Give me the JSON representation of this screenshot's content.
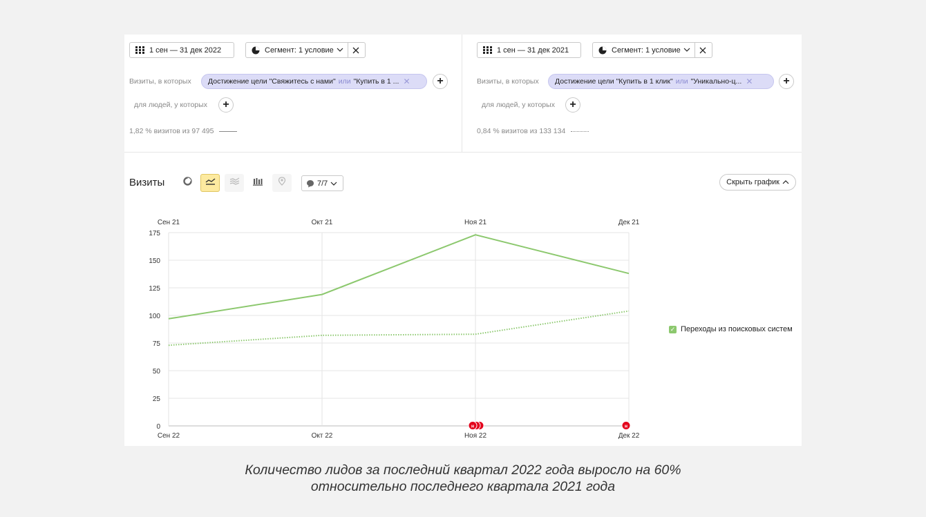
{
  "left_segment": {
    "date_label": "1 сен — 31 дек 2022",
    "segment_label": "Сегмент: 1 условие",
    "visits_label": "Визиты, в которых",
    "chip_text_a": "Достижение цели \"Свяжитесь с нами\"",
    "chip_or": "или",
    "chip_text_b": "\"Купить в 1 ...",
    "people_label": "для людей, у которых",
    "stat_text": "1,82 % визитов из 97 495"
  },
  "right_segment": {
    "date_label": "1 сен — 31 дек 2021",
    "segment_label": "Сегмент: 1 условие",
    "visits_label": "Визиты, в которых",
    "chip_text_a": "Достижение цели \"Купить в 1 клик\"",
    "chip_or": "или",
    "chip_text_b": "\"Уникально-ц...",
    "people_label": "для людей, у которых",
    "stat_text": "0,84 % визитов из 133 134"
  },
  "chart_header": {
    "title": "Визиты",
    "annotations_count": "7/7",
    "hide_label": "Скрыть график"
  },
  "legend": {
    "label": "Переходы из поисковых систем",
    "color": "#8cc86e"
  },
  "chart_data": {
    "type": "line",
    "categories_top": [
      "Сен 21",
      "Окт 21",
      "Ноя 21",
      "Дек 21"
    ],
    "categories_bottom": [
      "Сен 22",
      "Окт 22",
      "Ноя 22",
      "Дек 22"
    ],
    "yticks": [
      0,
      25,
      50,
      75,
      100,
      125,
      150,
      175
    ],
    "ylim": [
      0,
      175
    ],
    "series": [
      {
        "style": "solid",
        "values": [
          97,
          119,
          173,
          138
        ]
      },
      {
        "style": "dotted",
        "values": [
          73,
          82,
          83,
          104
        ]
      }
    ],
    "line_color": "#8cc86e",
    "markers": [
      {
        "category": "Ноя 22",
        "count": 3,
        "label": "н"
      },
      {
        "category": "Дек 22",
        "count": 1,
        "label": "н"
      }
    ],
    "marker_color": "#e3001b"
  },
  "caption": {
    "line1": "Количество лидов за последний квартал 2022 года выросло на 60%",
    "line2": "относительно последнего квартала 2021 года"
  }
}
